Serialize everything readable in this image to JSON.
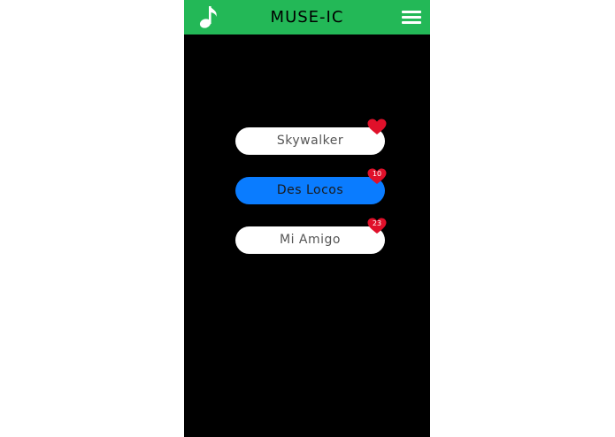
{
  "app": {
    "title": "MUSE-IC",
    "logo_icon": "music-note-icon",
    "menu_icon": "hamburger-menu-icon",
    "header_color": "#23b857",
    "background_color": "#000000"
  },
  "songs": [
    {
      "title": "Skywalker",
      "active": false,
      "likes": ""
    },
    {
      "title": "Des Locos",
      "active": true,
      "likes": "10"
    },
    {
      "title": "Mi Amigo",
      "active": false,
      "likes": "23"
    }
  ],
  "colors": {
    "pill_default": "#ffffff",
    "pill_active": "#0a7cff",
    "heart": "#e0102a"
  }
}
